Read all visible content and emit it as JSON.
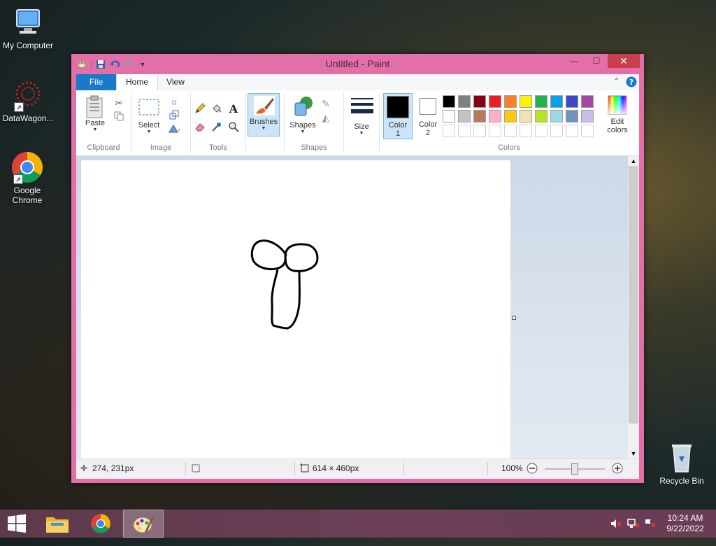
{
  "desktop": {
    "icons": [
      {
        "label": "My Computer"
      },
      {
        "label": "DataWagon..."
      },
      {
        "label": "Google Chrome"
      },
      {
        "label": "Recycle Bin"
      }
    ]
  },
  "window": {
    "title": "Untitled - Paint",
    "controls": {
      "minimize": "—",
      "maximize": "☐",
      "close": "✕"
    }
  },
  "ribbon": {
    "tabs": {
      "file": "File",
      "home": "Home",
      "view": "View"
    },
    "groups": {
      "clipboard": {
        "label": "Clipboard",
        "paste": "Paste"
      },
      "image": {
        "label": "Image",
        "select": "Select"
      },
      "tools": {
        "label": "Tools"
      },
      "brushes": {
        "label": "Brushes"
      },
      "shapes": {
        "label": "Shapes",
        "button": "Shapes"
      },
      "size": {
        "label": "Size"
      },
      "colors": {
        "label": "Colors",
        "color1_line1": "Color",
        "color1_line2": "1",
        "color2_line1": "Color",
        "color2_line2": "2",
        "edit_line1": "Edit",
        "edit_line2": "colors",
        "color1_value": "#000000",
        "color2_value": "#ffffff",
        "row1": [
          "#000000",
          "#7f7f7f",
          "#880015",
          "#ed1c24",
          "#ff7f27",
          "#fff200",
          "#22b14c",
          "#00a2e8",
          "#3f48cc",
          "#a349a4"
        ],
        "row2": [
          "#ffffff",
          "#c3c3c3",
          "#b97a57",
          "#ffaec9",
          "#ffc90e",
          "#efe4b0",
          "#b5e61d",
          "#99d9ea",
          "#7092be",
          "#c8bfe7"
        ]
      }
    }
  },
  "status": {
    "cursor_pos": "274, 231px",
    "image_size": "614 × 460px",
    "zoom": "100%"
  },
  "taskbar": {
    "time": "10:24 AM",
    "date": "9/22/2022"
  }
}
